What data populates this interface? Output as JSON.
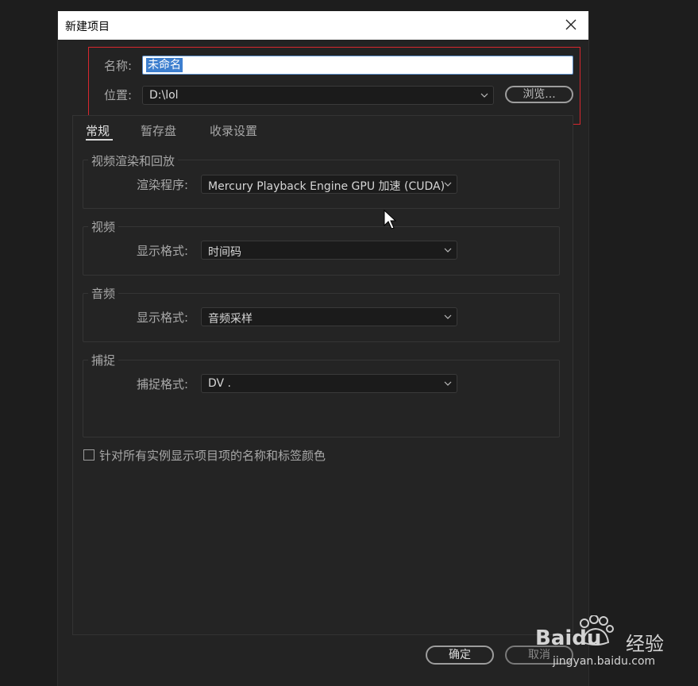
{
  "dialog": {
    "title": "新建项目",
    "name_label": "名称:",
    "name_value": "未命名",
    "location_label": "位置:",
    "location_value": "D:\\lol",
    "browse_label": "浏览...",
    "tabs": [
      "常规",
      "暂存盘",
      "收录设置"
    ],
    "groups": {
      "renderer": {
        "title": "视频渲染和回放",
        "label": "渲染程序:",
        "value": "Mercury Playback Engine GPU 加速 (CUDA)"
      },
      "video": {
        "title": "视频",
        "label": "显示格式:",
        "value": "时间码"
      },
      "audio": {
        "title": "音频",
        "label": "显示格式:",
        "value": "音频采样"
      },
      "capture": {
        "title": "捕捉",
        "label": "捕捉格式:",
        "value": "DV  ."
      }
    },
    "checkbox_label": "针对所有实例显示项目项的名称和标签颜色",
    "ok_label": "确定",
    "cancel_label": "取消"
  },
  "watermark": {
    "brand": "Baidu",
    "jingyan": "经验",
    "url": "jingyan.baidu.com"
  },
  "colors": {
    "highlight_box": "#d8272e",
    "selection": "#3d7fcf",
    "dialog_bg": "#232323",
    "page_bg": "#1d1d1d"
  }
}
